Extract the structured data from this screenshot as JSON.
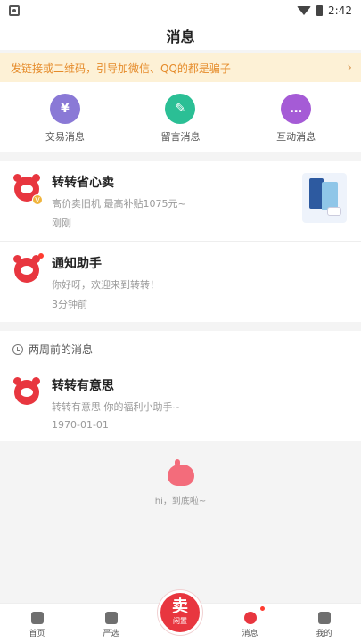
{
  "status": {
    "time": "2:42"
  },
  "header": {
    "title": "消息"
  },
  "notice": {
    "text": "发链接或二维码，引导加微信、QQ的都是骗子",
    "arrow": "›"
  },
  "categories": [
    {
      "label": "交易消息",
      "glyph": "¥",
      "color": "#8a79d6"
    },
    {
      "label": "留言消息",
      "glyph": "✎",
      "color": "#2bbf95"
    },
    {
      "label": "互动消息",
      "glyph": "…",
      "color": "#a55bd6"
    }
  ],
  "messages": [
    {
      "title": "转转省心卖",
      "subtitle": "高价卖旧机 最高补贴1075元~",
      "time": "刚刚",
      "badge": "V"
    },
    {
      "title": "通知助手",
      "subtitle": "你好呀，欢迎来到转转！",
      "time": "3分钟前"
    }
  ],
  "history": {
    "section_title": "两周前的消息",
    "items": [
      {
        "title": "转转有意思",
        "subtitle": "转转有意思 你的福利小助手~",
        "time": "1970-01-01"
      }
    ]
  },
  "end": {
    "text": "hi，到底啦~"
  },
  "tabbar": {
    "items": [
      {
        "label": "首页"
      },
      {
        "label": "严选"
      },
      {
        "label": "消息"
      },
      {
        "label": "我的"
      }
    ],
    "sell": {
      "main": "卖",
      "sub": "闲置"
    }
  }
}
